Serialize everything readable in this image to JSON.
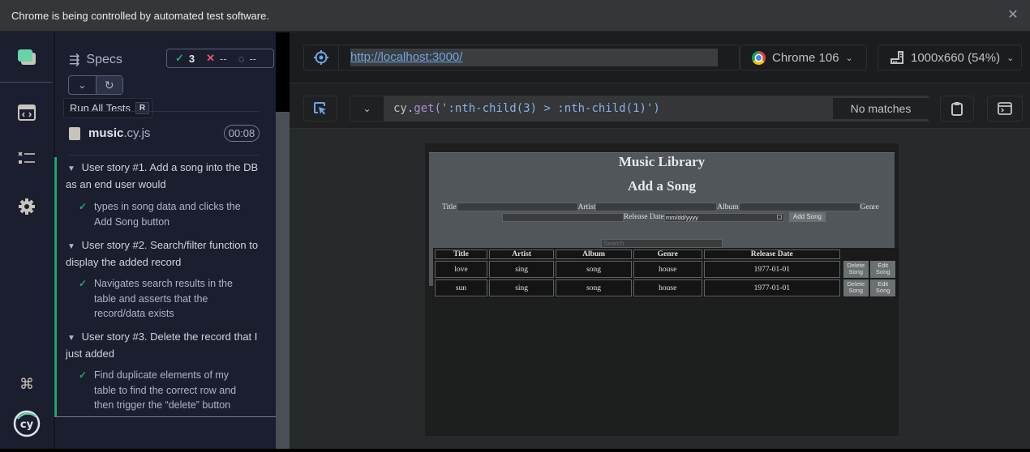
{
  "infobar": {
    "message": "Chrome is being controlled by automated test software.",
    "close_icon": "close-icon"
  },
  "nav": {
    "items": [
      {
        "name": "specs",
        "icon": "specs-icon",
        "active": true
      },
      {
        "name": "runs",
        "icon": "code-window-icon"
      },
      {
        "name": "debug",
        "icon": "test-list-icon"
      },
      {
        "name": "settings",
        "icon": "gear-icon"
      },
      {
        "name": "keyboard-shortcuts",
        "icon": "command-icon"
      },
      {
        "name": "cypress-logo",
        "icon": "cypress-logo-icon",
        "label": "cy"
      }
    ]
  },
  "specs_panel": {
    "title": "Specs",
    "stats": {
      "passed_icon": "✓",
      "passed": "3",
      "failed_icon": "✕",
      "failed": "--",
      "pending_icon": "◌",
      "pending": "--"
    },
    "tooltip": {
      "label": "Run All Tests",
      "shortcut": "R"
    },
    "spec_file": {
      "name": "music",
      "ext": ".cy.js",
      "duration": "00:08"
    },
    "suites": [
      {
        "title": "User story #1. Add a song into the DB as an end user would",
        "tests": [
          {
            "title": "types in song data and clicks the Add Song button",
            "status": "passed"
          }
        ]
      },
      {
        "title": "User story #2. Search/filter function to display the added record",
        "tests": [
          {
            "title": "Navigates search results in the table and asserts that the record/data exists",
            "status": "passed"
          }
        ]
      },
      {
        "title": "User story #3. Delete the record that I just added",
        "tests": [
          {
            "title": "Find duplicate elements of my table to find the correct row and then trigger the “delete” button",
            "status": "passed"
          }
        ]
      }
    ]
  },
  "toolbar": {
    "url": "http://localhost:3000/",
    "browser": "Chrome 106",
    "viewport": "1000x660 (54%)",
    "selector_prefix": "cy.",
    "selector_method": "get",
    "selector_arg": "(':nth-child(3) > :nth-child(1)')",
    "selector_result": "No matches"
  },
  "app": {
    "title": "Music Library",
    "subtitle": "Add a Song",
    "form": {
      "labels": {
        "title": "Title",
        "artist": "Artist",
        "album": "Album",
        "genre": "Genre",
        "release_date": "Release Date"
      },
      "date_placeholder": "mm/dd/yyyy",
      "add_button": "Add Song"
    },
    "search_placeholder": "Search",
    "table": {
      "headers": [
        "Title",
        "Artist",
        "Album",
        "Genre",
        "Release Date"
      ],
      "rows": [
        {
          "title": "love",
          "artist": "sing",
          "album": "song",
          "genre": "house",
          "release_date": "1977-01-01"
        },
        {
          "title": "sun",
          "artist": "sing",
          "album": "song",
          "genre": "house",
          "release_date": "1977-01-01"
        }
      ],
      "delete_label": "Delete Song",
      "edit_label": "Edit Song"
    }
  },
  "colors": {
    "accent_green": "#1fa971",
    "fail_red": "#e45770",
    "link_blue": "#6fa3e0"
  }
}
